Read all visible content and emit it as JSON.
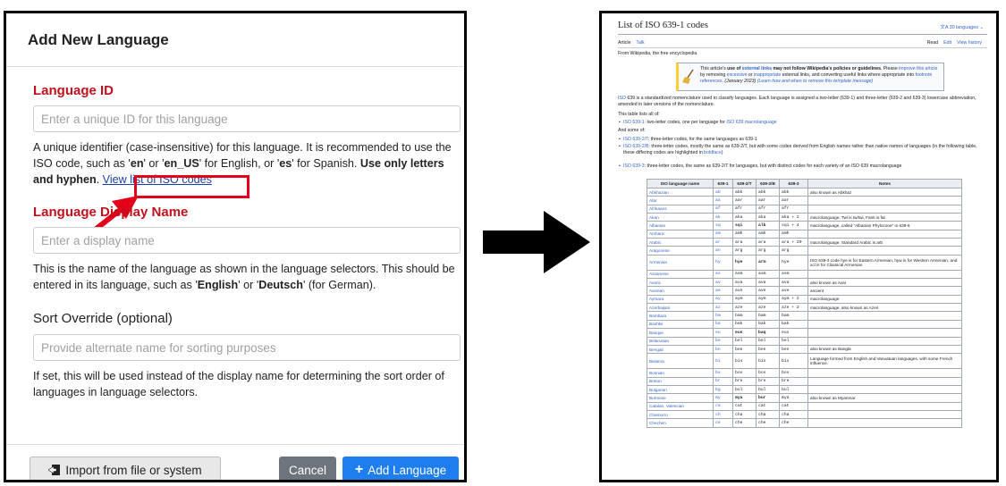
{
  "dialog": {
    "title": "Add New Language",
    "language_id": {
      "heading": "Language ID",
      "placeholder": "Enter a unique ID for this language",
      "help_1": "A unique identifier (case-insensitive) for this language. It is recommended to use the ISO code, such as '",
      "code_en": "en",
      "help_2": "' or '",
      "code_en_us": "en_US",
      "help_3": "' for English, or '",
      "code_es": "es",
      "help_4": "' for Spanish. ",
      "help_bold": "Use only letters and hyphen",
      "help_5": ". ",
      "iso_link": "View list of ISO codes"
    },
    "display_name": {
      "heading": "Language Display Name",
      "placeholder": "Enter a display name",
      "help_1": "This is the name of the language as shown in the language selectors. This should be entered in its language, such as '",
      "ex_1": "English",
      "help_2": "' or '",
      "ex_2": "Deutsch",
      "help_3": "' (for German)."
    },
    "sort_override": {
      "heading": "Sort Override (optional)",
      "placeholder": "Provide alternate name for sorting purposes",
      "help": "If set, this will be used instead of the display name for determining the sort order of languages in language selectors."
    },
    "buttons": {
      "import": "Import from file or system",
      "cancel": "Cancel",
      "add": "Add Language"
    }
  },
  "wiki": {
    "title": "List of ISO 639-1 codes",
    "languages": "30 languages",
    "tabs_left": [
      "Article",
      "Talk"
    ],
    "tabs_right": [
      "Read",
      "Edit",
      "View history"
    ],
    "from": "From Wikipedia, the free encyclopedia",
    "notice_1": "This article's ",
    "notice_bold_1": "use of ",
    "notice_link_1": "external links",
    "notice_bold_2": " may not follow Wikipedia's policies or guidelines",
    "notice_2": ". Please ",
    "notice_link_2": "improve this article",
    "notice_3": " by removing ",
    "notice_link_3": "excessive",
    "notice_4": " or ",
    "notice_link_4": "inappropriate",
    "notice_5": " external links, and converting useful links where appropriate into ",
    "notice_link_5": "footnote references",
    "notice_6": ". ",
    "notice_date": "(January 2023)",
    "notice_link_6": "(Learn how and when to remove this template message)",
    "intro_link": "ISO",
    "intro": " 639 is a standardized nomenclature used to classify languages. Each language is assigned a two-letter (639-1) and three-letter (639-2 and 639-3) lowercase abbreviation, amended in later versions of the nomenclature.",
    "list_all": "This table lists all of:",
    "bullet_1_link": "ISO 639-1",
    "bullet_1": ": two-letter codes, one per language for ",
    "bullet_1_link2": "ISO 639 macrolanguage",
    "and_some": "And some of:",
    "bullet_2_link": "ISO 639-2/T",
    "bullet_2": ": three-letter codes, for the same languages as 639-1",
    "bullet_3_link": "ISO 639-2/B",
    "bullet_3": ": three-letter codes, mostly the same as 639-2/T, but with some codes derived from English names rather than native names of languages (in the following table, these differing codes are highlighted in ",
    "bullet_3_link2": "boldface",
    "bullet_3_end": ")",
    "bullet_4_link": "ISO 639-3",
    "bullet_4": ": three-letter codes, the same as 639-2/T for languages, but with distinct codes for each variety of an ISO 639 macrolanguage",
    "table_headers": [
      "ISO language name",
      "639-1",
      "639-2/T",
      "639-2/B",
      "639-3",
      "Notes"
    ],
    "rows": [
      [
        "Abkhazian",
        "ab",
        "abk",
        "abk",
        "abk",
        "also known as Abkhaz"
      ],
      [
        "Afar",
        "aa",
        "aar",
        "aar",
        "aar",
        ""
      ],
      [
        "Afrikaans",
        "af",
        "afr",
        "afr",
        "afr",
        ""
      ],
      [
        "Akan",
        "ak",
        "aka",
        "aka",
        "aka + 2",
        "macrolanguage, Twi is tw/twi, Fanti is fat"
      ],
      [
        "Albanian",
        "sq",
        "sqi",
        "alb",
        "sqi + 4",
        "macrolanguage, called \"Albanian Phylozone\" in 639-6"
      ],
      [
        "Amharic",
        "am",
        "amh",
        "amh",
        "amh",
        ""
      ],
      [
        "Arabic",
        "ar",
        "ara",
        "ara",
        "ara + 29",
        "macrolanguage, Standard Arabic is arb"
      ],
      [
        "Aragonese",
        "an",
        "arg",
        "arg",
        "arg",
        ""
      ],
      [
        "Armenian",
        "hy",
        "hye",
        "arm",
        "hye",
        "ISO 639-3 code hye is for Eastern Armenian, hyw is for Western Armenian, and xcl is for Classical Armenian"
      ],
      [
        "Assamese",
        "as",
        "asm",
        "asm",
        "asm",
        ""
      ],
      [
        "Avaric",
        "av",
        "ava",
        "ava",
        "ava",
        "also known as Avar"
      ],
      [
        "Avestan",
        "ae",
        "ave",
        "ave",
        "ave",
        "ancient"
      ],
      [
        "Aymara",
        "ay",
        "aym",
        "aym",
        "aym + 2",
        "macrolanguage"
      ],
      [
        "Azerbaijani",
        "az",
        "aze",
        "aze",
        "aze + 2",
        "macrolanguage, also known as Azeri"
      ],
      [
        "Bambara",
        "bm",
        "bam",
        "bam",
        "bam",
        ""
      ],
      [
        "Bashkir",
        "ba",
        "bak",
        "bak",
        "bak",
        ""
      ],
      [
        "Basque",
        "eu",
        "eus",
        "baq",
        "eus",
        ""
      ],
      [
        "Belarusian",
        "be",
        "bel",
        "bel",
        "bel",
        ""
      ],
      [
        "Bengali",
        "bn",
        "ben",
        "ben",
        "ben",
        "also known as Bangla"
      ],
      [
        "Bislama",
        "bi",
        "bis",
        "bis",
        "bis",
        "Language formed from English and Vanuatuan languages, with some French influence."
      ],
      [
        "Bosnian",
        "bs",
        "bos",
        "bos",
        "bos",
        ""
      ],
      [
        "Breton",
        "br",
        "bre",
        "bre",
        "bre",
        ""
      ],
      [
        "Bulgarian",
        "bg",
        "bul",
        "bul",
        "bul",
        ""
      ],
      [
        "Burmese",
        "my",
        "mya",
        "bur",
        "mya",
        "also known as Myanmar"
      ],
      [
        "Catalan, Valencian",
        "ca",
        "cat",
        "cat",
        "cat",
        ""
      ],
      [
        "Chamorro",
        "ch",
        "cha",
        "cha",
        "cha",
        ""
      ],
      [
        "Chechen",
        "ce",
        "che",
        "che",
        "che",
        ""
      ]
    ]
  },
  "colors": {
    "section_red": "#c0111d",
    "link_blue": "#1a3fa8",
    "primary_btn": "#1e7ef0",
    "cancel_btn": "#6c757d",
    "highlight_red": "#e3001b"
  }
}
